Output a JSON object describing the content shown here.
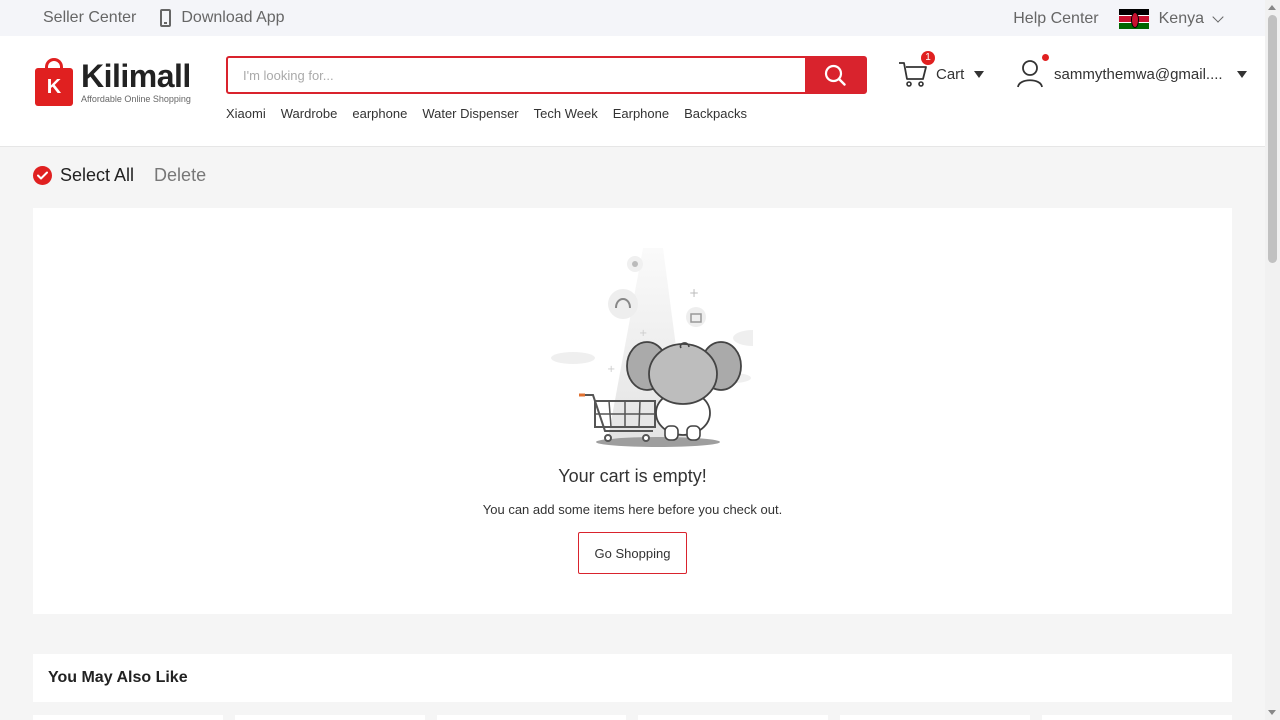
{
  "topbar": {
    "seller_center": "Seller Center",
    "download_app": "Download App",
    "help_center": "Help Center",
    "country": "Kenya"
  },
  "header": {
    "logo_name": "Kilimall",
    "logo_tagline": "Affordable Online Shopping",
    "search_placeholder": "I'm looking for...",
    "hot_words": [
      "Xiaomi",
      "Wardrobe",
      "earphone",
      "Water Dispenser",
      "Tech Week",
      "Earphone",
      "Backpacks"
    ],
    "cart_label": "Cart",
    "cart_count": "1",
    "user_email": "sammythemwa@gmail...."
  },
  "cart": {
    "select_all": "Select All",
    "delete": "Delete",
    "empty_title": "Your cart is empty!",
    "empty_subtitle": "You can add some items here before you check out.",
    "go_shopping": "Go Shopping"
  },
  "recommendations": {
    "title": "You May Also Like"
  },
  "colors": {
    "brand_red": "#d9232d",
    "background": "#f5f5f5"
  }
}
